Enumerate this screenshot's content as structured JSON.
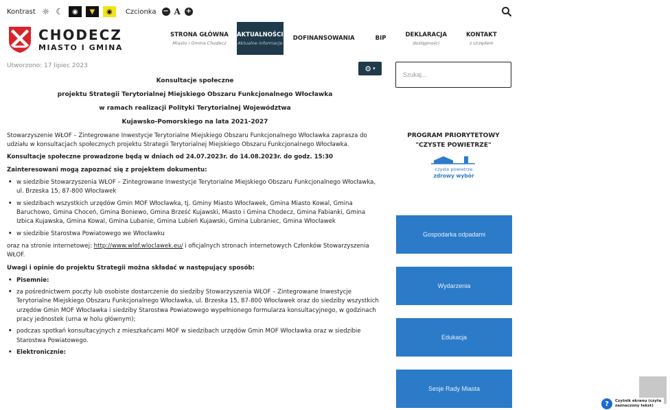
{
  "a11y": {
    "contrast_label": "Kontrast",
    "font_label": "Czcionka",
    "font_decrease": "−",
    "font_normal": "A",
    "font_increase": "+"
  },
  "logo": {
    "title": "CHODECZ",
    "subtitle": "MIASTO I GMINA"
  },
  "nav": [
    {
      "title": "STRONA GŁÓWNA",
      "sub": "Miasto i Gmina Chodecz",
      "active": false
    },
    {
      "title": "AKTUALNOŚCI",
      "sub": "Aktualne informacje",
      "active": true
    },
    {
      "title": "DOFINANSOWANIA",
      "sub": "",
      "active": false
    },
    {
      "title": "BIP",
      "sub": "",
      "active": false
    },
    {
      "title": "DEKLARACJA",
      "sub": "dostępności",
      "active": false
    },
    {
      "title": "KONTAKT",
      "sub": "z Urzędem",
      "active": false
    }
  ],
  "date": "Utworzono: 17 lipiec 2023",
  "search": {
    "placeholder": "Szukaj..."
  },
  "article": {
    "h1": "Konsultacje społeczne",
    "h2": "projektu Strategii Terytorialnej Miejskiego Obszaru Funkcjonalnego Włocławka",
    "h3": "w ramach realizacji Polityki Terytorialnej Województwa",
    "h4": "Kujawsko-Pomorskiego na lata 2021-2027",
    "p1": "Stowarzyszenie WŁOF – Zintegrowane Inwestycje Terytorialne Miejskiego Obszaru Funkcjonalnego Włocławka zaprasza do udziału w konsultacjach społecznych projektu Strategii Terytorialnej Miejskiego Obszaru Funkcjonalnego Włocławka.",
    "p2": "Konsultacje społeczne prowadzone będą w dniach od 24.07.2023r. do 14.08.2023r. do godz. 15:30",
    "p3": "Zainteresowani mogą zapoznać się z projektem dokumentu:",
    "list1": [
      "w siedzibie Stowarzyszenia WŁOF – Zintegrowane Inwestycje Terytorialne Miejskiego Obszaru Funkcjonalnego Włocławka, ul. Brzeska 15, 87-800 Włocławek",
      "w siedzibach wszystkich urzędów Gmin MOF Włocławka, tj. Gminy Miasto Włocławek, Gmina Miasto Kowal, Gmina Baruchowo, Gmina Choceń, Gmina Boniewo, Gmina Brześć Kujawski, Miasto i Gmina Chodecz, Gmina Fabianki, Gmina Izbica Kujawska, Gmina Kowal, Gmina Lubanie, Gmina Lubień Kujawski, Gmina Lubraniec, Gmina Włocławek",
      "w siedzibie Starostwa Powiatowego we Włocławku"
    ],
    "p4_before": "oraz na stronie internetowej: ",
    "p4_link": "http://www.wlof.wloclawek.eu/",
    "p4_after": "  i  oficjalnych stronach internetowych Członków Stowarzyszenia WŁOF.",
    "p5": "Uwagi i opinie do projektu Strategii można składać w następujący sposób:",
    "pisemnie": "Pisemnie:",
    "list2": [
      "za pośrednictwem poczty lub osobiste dostarczenie do siedziby Stowarzyszenia WŁOF – Zintegrowane Inwestycje Terytorialne Miejskiego Obszaru Funkcjonalnego Włocławka, ul. Brzeska 15, 87-800 Włocławek oraz do siedziby wszystkich urzędów Gmin MOF Włocławka i siedziby Starostwa Powiatowego wypełnionego formularza konsultacyjnego, w godzinach pracy jednostek (urna w holu głównym);",
      "podczas spotkań konsultacyjnych z mieszkańcami MOF w siedzibach urzędów Gmin MOF Włocławka oraz w siedzibie Starostwa Powiatowego."
    ],
    "elektronicznie": "Elektronicznie:"
  },
  "sidebar": {
    "program_line1": "PROGRAM PRIORYTETOWY",
    "program_line2": "\"CZYSTE POWIETRZE\"",
    "program_logo_text1": "czyste powietrze",
    "program_logo_text2": "zdrowy wybór",
    "buttons": [
      "Gospodarka odpadami",
      "Wydarzenia",
      "Edukacja",
      "Sesje Rady Miasta"
    ]
  },
  "reader": {
    "line1": "Czytnik ekranu (czyta",
    "line2": "zaznaczony tekst)"
  }
}
